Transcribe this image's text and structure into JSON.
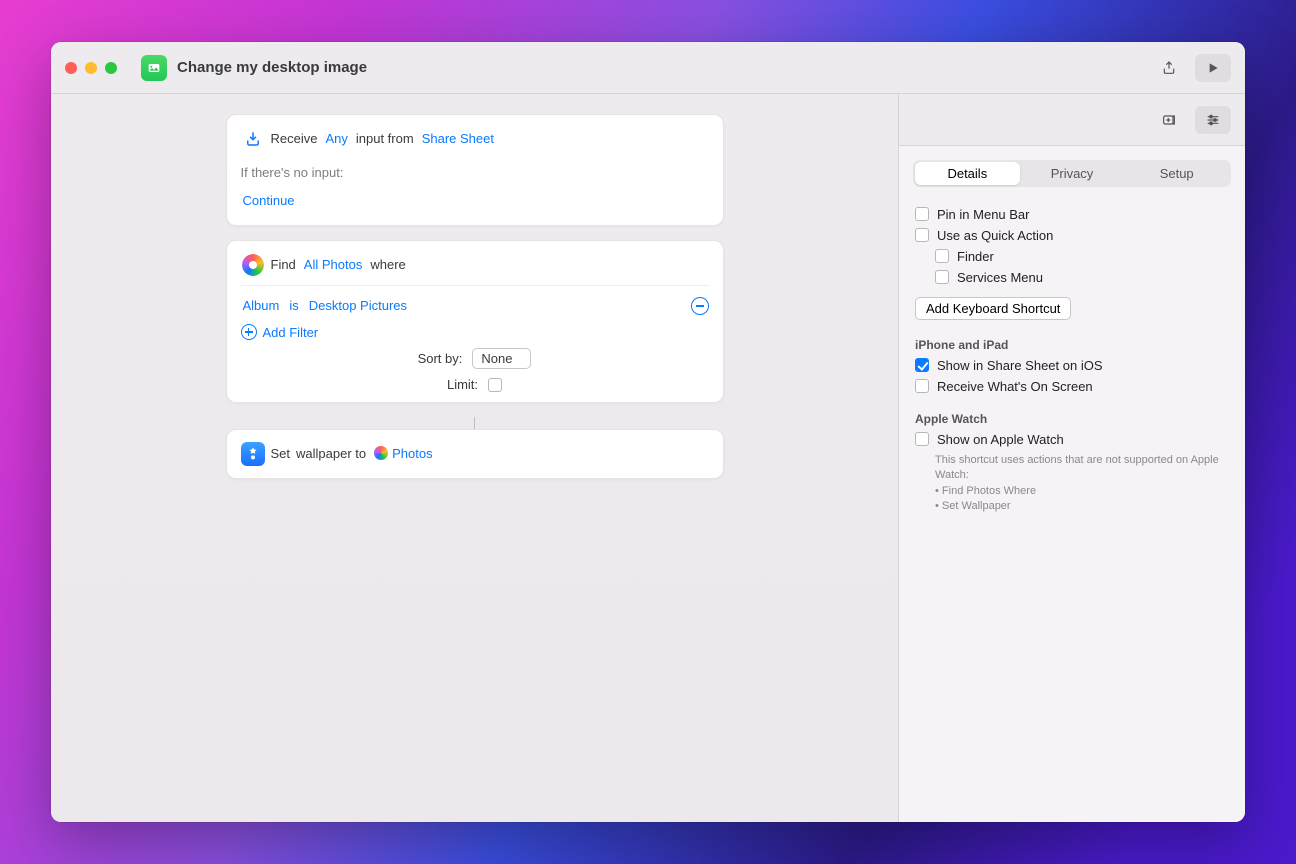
{
  "window": {
    "title": "Change my desktop image"
  },
  "receive": {
    "receive": "Receive",
    "any": "Any",
    "input_from": "input from",
    "share_sheet": "Share Sheet",
    "no_input_label": "If there's no input:",
    "continue_label": "Continue"
  },
  "find": {
    "find": "Find",
    "all_photos": "All Photos",
    "where": "where",
    "field": "Album",
    "op": "is",
    "value": "Desktop Pictures",
    "add_filter": "Add Filter",
    "sort_by_label": "Sort by:",
    "sort_by_value": "None",
    "limit_label": "Limit:"
  },
  "set": {
    "set": "Set",
    "wallpaper_to": "wallpaper to",
    "photos": "Photos"
  },
  "tabs": {
    "details": "Details",
    "privacy": "Privacy",
    "setup": "Setup"
  },
  "details": {
    "pin_menu_bar": "Pin in Menu Bar",
    "quick_action": "Use as Quick Action",
    "finder": "Finder",
    "services_menu": "Services Menu",
    "add_shortcut": "Add Keyboard Shortcut",
    "section_iphone": "iPhone and iPad",
    "show_share_sheet_ios": "Show in Share Sheet on iOS",
    "receive_on_screen": "Receive What's On Screen",
    "section_watch": "Apple Watch",
    "show_on_watch": "Show on Apple Watch",
    "watch_note_1": "This shortcut uses actions that are not supported on Apple Watch:",
    "watch_note_2": "• Find Photos Where",
    "watch_note_3": "• Set Wallpaper"
  }
}
